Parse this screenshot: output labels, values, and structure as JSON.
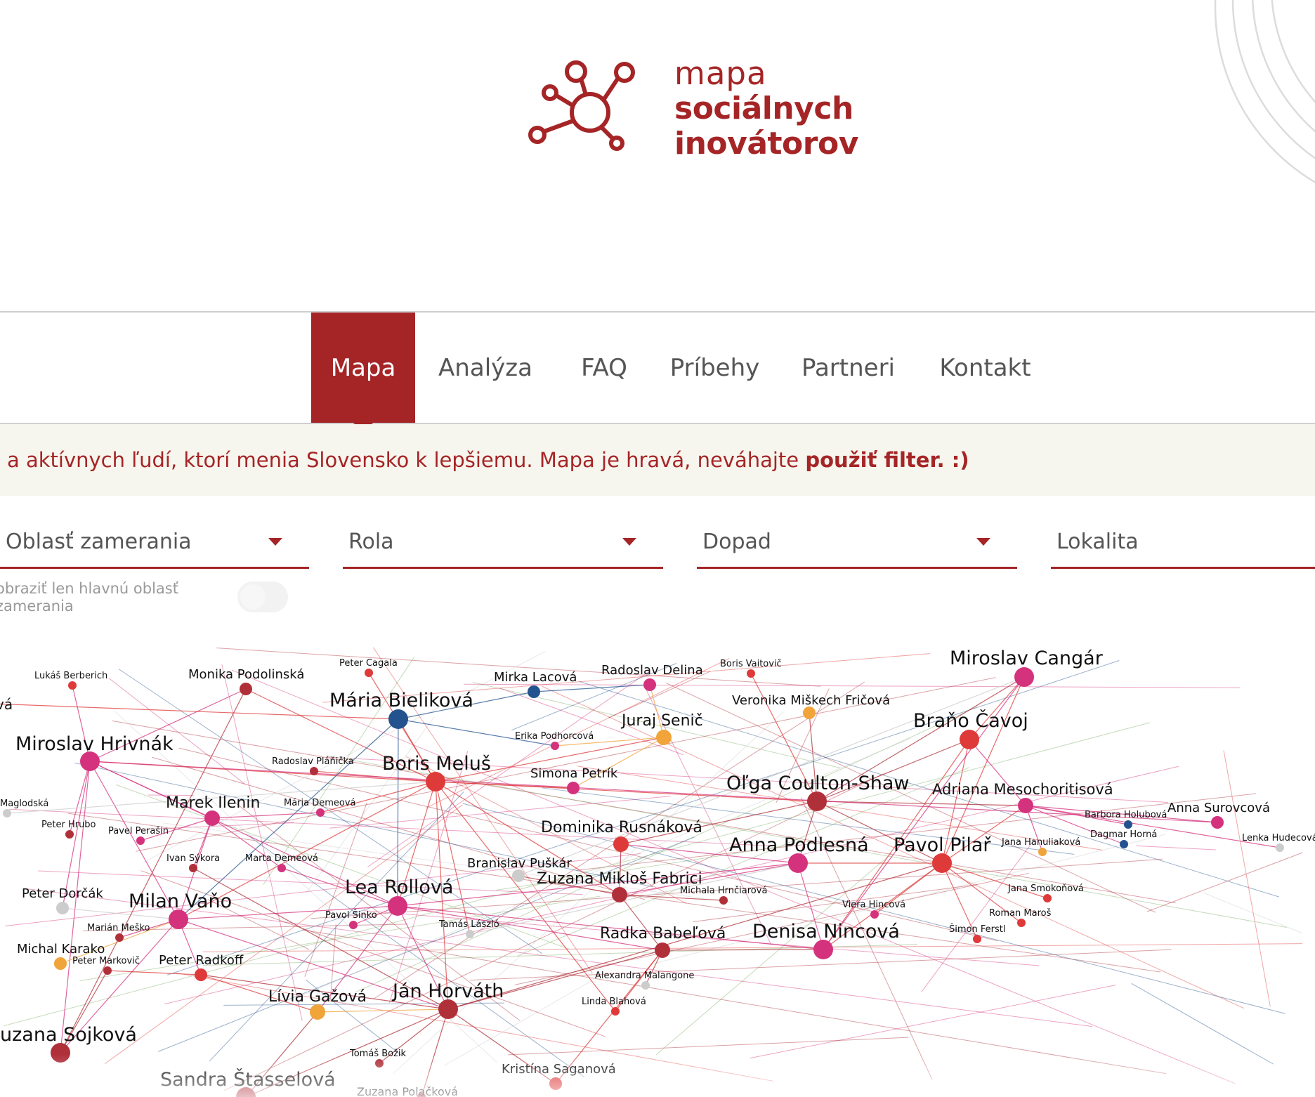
{
  "logo": {
    "line1": "mapa",
    "line2": "sociálnych",
    "line3": "inovátorov",
    "color": "#a52526"
  },
  "nav": {
    "items": [
      {
        "label": "Mapa",
        "active": true
      },
      {
        "label": "Analýza",
        "active": false
      },
      {
        "label": "FAQ",
        "active": false
      },
      {
        "label": "Príbehy",
        "active": false
      },
      {
        "label": "Partneri",
        "active": false
      },
      {
        "label": "Kontakt",
        "active": false
      }
    ]
  },
  "intro": {
    "text": "a aktívnych ľudí, ktorí menia Slovensko k lepšiemu. Mapa je hravá, neváhajte ",
    "link": "použiť filter. :)"
  },
  "filters": [
    {
      "label": "Oblasť zamerania"
    },
    {
      "label": "Rola"
    },
    {
      "label": "Dopad"
    },
    {
      "label": "Lokalita"
    }
  ],
  "toggle": {
    "label": "obraziť len hlavnú oblasť zamerania",
    "state": "off"
  },
  "colors": {
    "brand": "#a52526",
    "pink": "#d4327d",
    "red": "#df3a3a",
    "darkred": "#b0303a",
    "blue": "#23538f",
    "orange": "#f0a43a",
    "gray": "#cccccc"
  },
  "nodes": [
    {
      "name": "Miroslav Cangár",
      "size": "big",
      "color": "pink"
    },
    {
      "name": "Mária Bieliková",
      "size": "big",
      "color": "blue"
    },
    {
      "name": "Miroslav Hrivnák",
      "size": "big",
      "color": "pink"
    },
    {
      "name": "Boris Meluš",
      "size": "big",
      "color": "red"
    },
    {
      "name": "Braňo Čavoj",
      "size": "big",
      "color": "red"
    },
    {
      "name": "Oľga Coulton-Shaw",
      "size": "big",
      "color": "darkred"
    },
    {
      "name": "Adriana Mesochoritisová",
      "size": "mid",
      "color": "pink"
    },
    {
      "name": "Marek Ilenin",
      "size": "mid",
      "color": "pink"
    },
    {
      "name": "Anna Podlesná",
      "size": "big",
      "color": "pink"
    },
    {
      "name": "Pavol Pilař",
      "size": "big",
      "color": "red"
    },
    {
      "name": "Dominika Rusnáková",
      "size": "mid",
      "color": "red"
    },
    {
      "name": "Juraj Senič",
      "size": "mid",
      "color": "orange"
    },
    {
      "name": "Lea Rollová",
      "size": "big",
      "color": "pink"
    },
    {
      "name": "Zuzana Mikloš Fabrici",
      "size": "mid",
      "color": "darkred"
    },
    {
      "name": "Milan Vaňo",
      "size": "big",
      "color": "pink"
    },
    {
      "name": "Radka Babeľová",
      "size": "mid",
      "color": "darkred"
    },
    {
      "name": "Denisa Nincová",
      "size": "big",
      "color": "pink"
    },
    {
      "name": "Ján Horváth",
      "size": "big",
      "color": "darkred"
    },
    {
      "name": "Lívia Gažová",
      "size": "mid",
      "color": "orange"
    },
    {
      "name": "uzana Sojková",
      "size": "big",
      "color": "darkred"
    },
    {
      "name": "Sandra Štasselová",
      "size": "big",
      "color": "darkred"
    },
    {
      "name": "Monika Podolinská",
      "size": "small",
      "color": "darkred"
    },
    {
      "name": "Radoslav Delina",
      "size": "small",
      "color": "pink"
    },
    {
      "name": "Mirka Lacová",
      "size": "small",
      "color": "blue"
    },
    {
      "name": "Veronika Miškech Fričová",
      "size": "small",
      "color": "orange"
    },
    {
      "name": "Simona Petrík",
      "size": "small",
      "color": "pink"
    },
    {
      "name": "Branislav Puškár",
      "size": "small",
      "color": "gray"
    },
    {
      "name": "Peter Dorčák",
      "size": "small",
      "color": "gray"
    },
    {
      "name": "Peter Radkoff",
      "size": "small",
      "color": "red"
    },
    {
      "name": "Michal Karako",
      "size": "small",
      "color": "orange"
    },
    {
      "name": "Anna Surovcová",
      "size": "small",
      "color": "pink"
    },
    {
      "name": "Peter Cagala",
      "size": "tiny",
      "color": "red"
    },
    {
      "name": "Lukáš Berberich",
      "size": "tiny",
      "color": "red"
    },
    {
      "name": "Boris Vaitovič",
      "size": "tiny",
      "color": "red"
    },
    {
      "name": "Erika Podhorcová",
      "size": "tiny",
      "color": "pink"
    },
    {
      "name": "Radoslav Pláňička",
      "size": "tiny",
      "color": "darkred"
    },
    {
      "name": "Mária Demeová",
      "size": "tiny",
      "color": "pink"
    },
    {
      "name": "Peter Hrubo",
      "size": "tiny",
      "color": "darkred"
    },
    {
      "name": "Pavel Perašin",
      "size": "tiny",
      "color": "pink"
    },
    {
      "name": "Ivan Sýkora",
      "size": "tiny",
      "color": "darkred"
    },
    {
      "name": "Marta Demeová",
      "size": "tiny",
      "color": "pink"
    },
    {
      "name": "Maglodská",
      "size": "tiny",
      "color": "gray"
    },
    {
      "name": "Marián Meško",
      "size": "tiny",
      "color": "darkred"
    },
    {
      "name": "Peter Markovič",
      "size": "tiny",
      "color": "darkred"
    },
    {
      "name": "Pavol Šinko",
      "size": "tiny",
      "color": "pink"
    },
    {
      "name": "Tamás László",
      "size": "tiny",
      "color": "gray"
    },
    {
      "name": "Michala Hrnčiarová",
      "size": "tiny",
      "color": "darkred"
    },
    {
      "name": "Alexandra Malangone",
      "size": "tiny",
      "color": "gray"
    },
    {
      "name": "Linda Blahová",
      "size": "tiny",
      "color": "red"
    },
    {
      "name": "Viera Hincová",
      "size": "tiny",
      "color": "pink"
    },
    {
      "name": "Jana Smokoňová",
      "size": "tiny",
      "color": "red"
    },
    {
      "name": "Roman Maroš",
      "size": "tiny",
      "color": "red"
    },
    {
      "name": "Šimon Ferstl",
      "size": "tiny",
      "color": "red"
    },
    {
      "name": "Barbora Holubová",
      "size": "tiny",
      "color": "blue"
    },
    {
      "name": "Dagmar Horná",
      "size": "tiny",
      "color": "blue"
    },
    {
      "name": "Jana Hanuliaková",
      "size": "tiny",
      "color": "orange"
    },
    {
      "name": "Lenka Hudecová",
      "size": "tiny",
      "color": "gray"
    },
    {
      "name": "Tomáš Božik",
      "size": "tiny",
      "color": "darkred"
    },
    {
      "name": "Kristína Saganová",
      "size": "small",
      "color": "red"
    },
    {
      "name": "Zuzana Polačková",
      "size": "tiny",
      "color": "darkred"
    },
    {
      "name": "vá",
      "size": "tiny",
      "color": "red"
    }
  ],
  "edges": [
    [
      "Boris Meluš",
      "Mária Bieliková"
    ],
    [
      "Boris Meluš",
      "Lea Rollová"
    ],
    [
      "Boris Meluš",
      "Ján Horváth"
    ],
    [
      "Boris Meluš",
      "Miroslav Hrivnák"
    ],
    [
      "Boris Meluš",
      "Radoslav Pláňička"
    ],
    [
      "Boris Meluš",
      "Simona Petrík"
    ],
    [
      "Boris Meluš",
      "Oľga Coulton-Shaw"
    ],
    [
      "Boris Meluš",
      "Zuzana Mikloš Fabrici"
    ],
    [
      "Boris Meluš",
      "Milan Vaňo"
    ],
    [
      "Boris Meluš",
      "Peter Cagala"
    ],
    [
      "Boris Meluš",
      "Monika Podolinská"
    ],
    [
      "Boris Meluš",
      "Mária Demeová"
    ],
    [
      "Boris Meluš",
      "Tamás László"
    ],
    [
      "Boris Meluš",
      "Linda Blahová"
    ],
    [
      "Boris Meluš",
      "Juraj Senič"
    ],
    [
      "Mária Bieliková",
      "Mirka Lacová"
    ],
    [
      "Mária Bieliková",
      "Lea Rollová"
    ],
    [
      "Mária Bieliková",
      "Milan Vaňo"
    ],
    [
      "Mária Bieliková",
      "Erika Podhorcová"
    ],
    [
      "Miroslav Hrivnák",
      "Marek Ilenin"
    ],
    [
      "Miroslav Hrivnák",
      "Milan Vaňo"
    ],
    [
      "Miroslav Hrivnák",
      "Peter Hrubo"
    ],
    [
      "Miroslav Hrivnák",
      "Lukáš Berberich"
    ],
    [
      "Miroslav Hrivnák",
      "uzana Sojková"
    ],
    [
      "Miroslav Hrivnák",
      "Peter Dorčák"
    ],
    [
      "Miroslav Hrivnák",
      "Monika Podolinská"
    ],
    [
      "Miroslav Hrivnák",
      "Lea Rollová"
    ],
    [
      "Milan Vaňo",
      "Peter Radkoff"
    ],
    [
      "Milan Vaňo",
      "Lea Rollová"
    ],
    [
      "Milan Vaňo",
      "Marek Ilenin"
    ],
    [
      "Milan Vaňo",
      "Ján Horváth"
    ],
    [
      "Milan Vaňo",
      "uzana Sojková"
    ],
    [
      "Milan Vaňo",
      "Marián Meško"
    ],
    [
      "Lea Rollová",
      "Ján Horváth"
    ],
    [
      "Lea Rollová",
      "Denisa Nincová"
    ],
    [
      "Lea Rollová",
      "Radka Babeľová"
    ],
    [
      "Lea Rollová",
      "Anna Podlesná"
    ],
    [
      "Lea Rollová",
      "Lívia Gažová"
    ],
    [
      "Lea Rollová",
      "Pavol Šinko"
    ],
    [
      "Ján Horváth",
      "Radka Babeľová"
    ],
    [
      "Ján Horváth",
      "Kristína Saganová"
    ],
    [
      "Ján Horváth",
      "Sandra Štasselová"
    ],
    [
      "Ján Horváth",
      "Tomáš Božik"
    ],
    [
      "Ján Horváth",
      "Zuzana Polačková"
    ],
    [
      "Ján Horváth",
      "Peter Radkoff"
    ],
    [
      "Ján Horváth",
      "Pavol Pilař"
    ],
    [
      "Oľga Coulton-Shaw",
      "Braňo Čavoj"
    ],
    [
      "Oľga Coulton-Shaw",
      "Anna Podlesná"
    ],
    [
      "Oľga Coulton-Shaw",
      "Pavol Pilař"
    ],
    [
      "Oľga Coulton-Shaw",
      "Dominika Rusnáková"
    ],
    [
      "Oľga Coulton-Shaw",
      "Miroslav Cangár"
    ],
    [
      "Oľga Coulton-Shaw",
      "Veronika Miškech Fričová"
    ],
    [
      "Oľga Coulton-Shaw",
      "Adriana Mesochoritisová"
    ],
    [
      "Pavol Pilař",
      "Braňo Čavoj"
    ],
    [
      "Pavol Pilař",
      "Adriana Mesochoritisová"
    ],
    [
      "Pavol Pilař",
      "Denisa Nincová"
    ],
    [
      "Pavol Pilař",
      "Jana Smokoňová"
    ],
    [
      "Pavol Pilař",
      "Roman Maroš"
    ],
    [
      "Pavol Pilař",
      "Šimon Ferstl"
    ],
    [
      "Pavol Pilař",
      "Viera Hincová"
    ],
    [
      "Pavol Pilař",
      "Anna Podlesná"
    ],
    [
      "Pavol Pilař",
      "Miroslav Cangár"
    ],
    [
      "Adriana Mesochoritisová",
      "Anna Surovcová"
    ],
    [
      "Adriana Mesochoritisová",
      "Barbora Holubová"
    ],
    [
      "Adriana Mesochoritisová",
      "Dagmar Horná"
    ],
    [
      "Adriana Mesochoritisová",
      "Jana Hanuliaková"
    ],
    [
      "Adriana Mesochoritisová",
      "Lenka Hudecová"
    ],
    [
      "Adriana Mesochoritisová",
      "Braňo Čavoj"
    ],
    [
      "Anna Podlesná",
      "Dominika Rusnáková"
    ],
    [
      "Anna Podlesná",
      "Zuzana Mikloš Fabrici"
    ],
    [
      "Anna Podlesná",
      "Denisa Nincová"
    ],
    [
      "Radka Babeľová",
      "Denisa Nincová"
    ],
    [
      "Radka Babeľová",
      "Alexandra Malangone"
    ],
    [
      "Radka Babeľová",
      "Zuzana Mikloš Fabrici"
    ],
    [
      "Zuzana Mikloš Fabrici",
      "Branislav Puškár"
    ],
    [
      "Zuzana Mikloš Fabrici",
      "Michala Hrnčiarová"
    ],
    [
      "Zuzana Mikloš Fabrici",
      "Dominika Rusnáková"
    ],
    [
      "Braňo Čavoj",
      "Miroslav Cangár"
    ],
    [
      "Braňo Čavoj",
      "Denisa Nincová"
    ],
    [
      "Juraj Senič",
      "Radoslav Delina"
    ],
    [
      "Juraj Senič",
      "Erika Podhorcová"
    ],
    [
      "Juraj Senič",
      "Simona Petrík"
    ],
    [
      "Marek Ilenin",
      "Pavel Perašin"
    ],
    [
      "Marek Ilenin",
      "Ivan Sýkora"
    ],
    [
      "Marek Ilenin",
      "Marta Demeová"
    ],
    [
      "Marek Ilenin",
      "Mária Demeová"
    ],
    [
      "Peter Radkoff",
      "Peter Markovič"
    ],
    [
      "Peter Radkoff",
      "Lívia Gažová"
    ],
    [
      "Michal Karako",
      "Milan Vaňo"
    ],
    [
      "Peter Dorčák",
      "Milan Vaňo"
    ],
    [
      "Lívia Gažová",
      "Ján Horváth"
    ],
    [
      "uzana Sojková",
      "Peter Markovič"
    ],
    [
      "Sandra Štasselová",
      "Lívia Gažová"
    ],
    [
      "Denisa Nincová",
      "Miroslav Cangár"
    ],
    [
      "Kristína Saganová",
      "Radka Babeľová"
    ],
    [
      "Linda Blahová",
      "Radka Babeľová"
    ],
    [
      "Mirka Lacová",
      "Radoslav Delina"
    ],
    [
      "Boris Vaitovič",
      "Oľga Coulton-Shaw"
    ],
    [
      "Monika Podolinská",
      "uzana Sojková"
    ],
    [
      "Marta Demeová",
      "Lea Rollová"
    ],
    [
      "Ivan Sýkora",
      "Ján Horváth"
    ],
    [
      "Maglodská",
      "Boris Meluš"
    ],
    [
      "vá",
      "Mária Bieliková"
    ],
    [
      "Tamás László",
      "Anna Podlesná"
    ],
    [
      "Branislav Puškár",
      "Miroslav Cangár"
    ],
    [
      "Miroslav Hrivnák",
      "Anna Surovcová"
    ]
  ]
}
